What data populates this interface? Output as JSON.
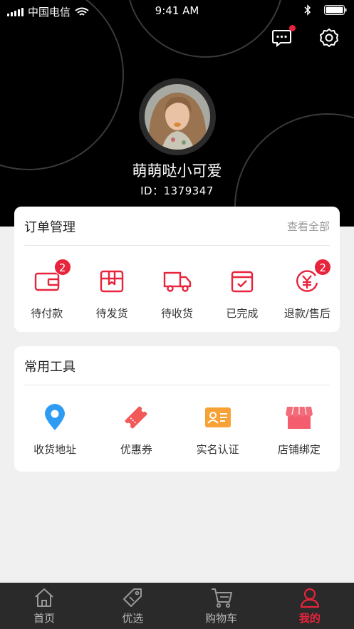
{
  "status_bar": {
    "carrier": "中国电信",
    "time": "9:41 AM"
  },
  "header": {
    "message_icon": "message-icon",
    "settings_icon": "gear-icon"
  },
  "profile": {
    "nickname": "萌萌哒小可爱",
    "user_id": "ID：1379347"
  },
  "orders": {
    "title": "订单管理",
    "more": "查看全部",
    "items": [
      {
        "label": "待付款",
        "icon": "wallet-icon",
        "badge": "2"
      },
      {
        "label": "待发货",
        "icon": "package-icon",
        "badge": ""
      },
      {
        "label": "待收货",
        "icon": "truck-icon",
        "badge": ""
      },
      {
        "label": "已完成",
        "icon": "calendar-check-icon",
        "badge": ""
      },
      {
        "label": "退款/售后",
        "icon": "refund-icon",
        "badge": "2"
      }
    ]
  },
  "tools": {
    "title": "常用工具",
    "items": [
      {
        "label": "收货地址",
        "icon": "location-pin-icon"
      },
      {
        "label": "优惠券",
        "icon": "coupon-icon"
      },
      {
        "label": "实名认证",
        "icon": "id-card-icon"
      },
      {
        "label": "店铺绑定",
        "icon": "store-icon"
      }
    ]
  },
  "tabbar": {
    "items": [
      {
        "label": "首页",
        "icon": "home-icon",
        "active": false
      },
      {
        "label": "优选",
        "icon": "tag-icon",
        "active": false
      },
      {
        "label": "购物车",
        "icon": "cart-icon",
        "active": false
      },
      {
        "label": "我的",
        "icon": "user-icon",
        "active": true
      }
    ]
  },
  "colors": {
    "accent": "#e8243c",
    "header_bg": "#000000",
    "page_bg": "#f0f0f0",
    "tabbar_bg": "#2a2a2a"
  }
}
